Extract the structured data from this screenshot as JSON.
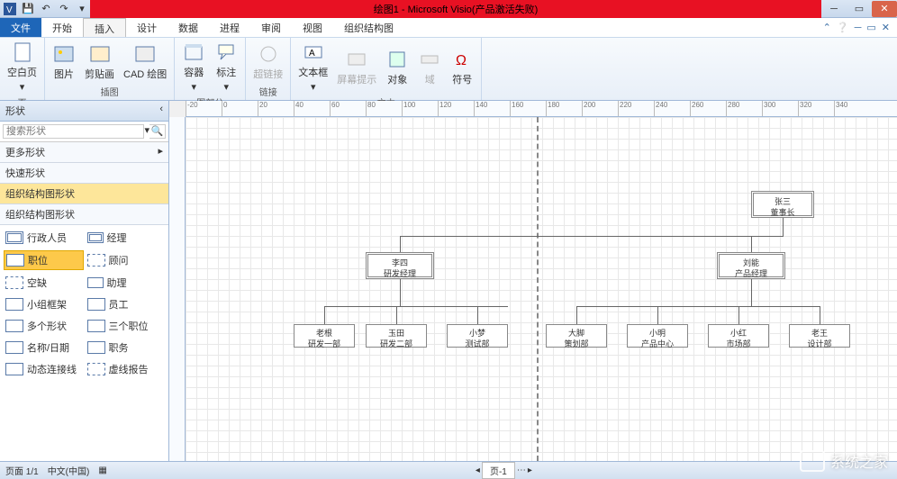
{
  "title": "绘图1 - Microsoft Visio(产品激活失败)",
  "qat": [
    "save",
    "undo",
    "redo"
  ],
  "tabs": {
    "file": "文件",
    "list": [
      "开始",
      "插入",
      "设计",
      "数据",
      "进程",
      "审阅",
      "视图",
      "组织结构图"
    ],
    "active": "插入"
  },
  "ribbon": {
    "g1": {
      "label": "页",
      "items": [
        {
          "l": "空白页"
        }
      ]
    },
    "g2": {
      "label": "插图",
      "items": [
        {
          "l": "图片"
        },
        {
          "l": "剪贴画"
        },
        {
          "l": "CAD 绘图"
        }
      ]
    },
    "g3": {
      "label": "图部分",
      "items": [
        {
          "l": "容器"
        },
        {
          "l": "标注"
        }
      ]
    },
    "g4": {
      "label": "链接",
      "items": [
        {
          "l": "超链接",
          "dis": true
        }
      ]
    },
    "g5": {
      "label": "文本",
      "items": [
        {
          "l": "文本框"
        },
        {
          "l": "屏幕提示",
          "dis": true
        },
        {
          "l": "对象"
        },
        {
          "l": "域",
          "dis": true
        },
        {
          "l": "符号"
        }
      ]
    }
  },
  "shapes": {
    "header": "形状",
    "search_placeholder": "搜索形状",
    "rows": [
      "更多形状",
      "快速形状",
      "组织结构图形状",
      "组织结构图形状"
    ],
    "sel_row": 2,
    "items": [
      {
        "l": "行政人员",
        "k": "double"
      },
      {
        "l": "经理",
        "k": "double tiny"
      },
      {
        "l": "职位",
        "k": "sgl",
        "sel": true
      },
      {
        "l": "顾问",
        "k": "dash"
      },
      {
        "l": "空缺",
        "k": "dash"
      },
      {
        "l": "助理",
        "k": "sgl tiny"
      },
      {
        "l": "小组框架",
        "k": "sgl"
      },
      {
        "l": "员工",
        "k": "sgl"
      },
      {
        "l": "多个形状",
        "k": "sgl"
      },
      {
        "l": "三个职位",
        "k": "sgl"
      },
      {
        "l": "名称/日期",
        "k": "sgl"
      },
      {
        "l": "职务",
        "k": "sgl"
      },
      {
        "l": "动态连接线",
        "k": "sgl"
      },
      {
        "l": "虚线报告",
        "k": "dash"
      }
    ]
  },
  "org": {
    "top": {
      "n": "张三",
      "t": "董事长"
    },
    "mgrs": [
      {
        "n": "李四",
        "t": "研发经理"
      },
      {
        "n": "刘能",
        "t": "产品经理"
      }
    ],
    "leaves_left": [
      {
        "n": "老根",
        "t": "研发一部"
      },
      {
        "n": "玉田",
        "t": "研发二部"
      },
      {
        "n": "小梦",
        "t": "测试部"
      }
    ],
    "leaves_right": [
      {
        "n": "大脚",
        "t": "策划部"
      },
      {
        "n": "小明",
        "t": "产品中心"
      },
      {
        "n": "小红",
        "t": "市场部"
      },
      {
        "n": "老王",
        "t": "设计部"
      }
    ]
  },
  "status": {
    "page": "页面 1/1",
    "lang": "中文(中国)",
    "tab": "页-1"
  },
  "watermark": "系统之家"
}
